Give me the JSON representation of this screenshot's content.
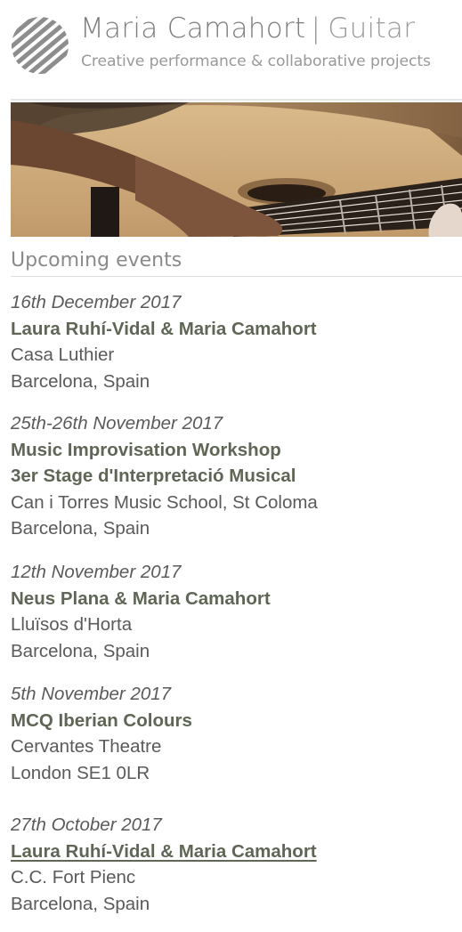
{
  "header": {
    "site_name": "Maria Camahort",
    "separator": "|",
    "instrument": "Guitar",
    "tagline": "Creative performance & collaborative projects",
    "logo_icon": "striped-circle-logo"
  },
  "hero": {
    "image": "guitar-player-hands-photo"
  },
  "section": {
    "title": "Upcoming events"
  },
  "events": [
    {
      "date": "16th December 2017",
      "titles": [
        "Laura Ruhí-Vidal & Maria Camahort"
      ],
      "venue": "Casa Luthier",
      "location": "Barcelona, Spain",
      "linked": false
    },
    {
      "date": "25th-26th November 2017",
      "titles": [
        "Music Improvisation Workshop",
        "3er Stage d'Interpretació Musical"
      ],
      "venue": "Can i Torres Music School, St Coloma",
      "location": "Barcelona, Spain",
      "linked": false
    },
    {
      "date": "12th November 2017",
      "titles": [
        "Neus Plana & Maria Camahort"
      ],
      "venue": "Lluïsos d'Horta",
      "location": "Barcelona, Spain",
      "linked": false
    },
    {
      "date": "5th November 2017",
      "titles": [
        "MCQ Iberian Colours"
      ],
      "venue": "Cervantes Theatre",
      "location": "London SE1 0LR",
      "linked": false
    },
    {
      "date": "27th October 2017",
      "titles": [
        "Laura Ruhí-Vidal & Maria Camahort"
      ],
      "venue": "C.C. Fort Pienc",
      "location": "Barcelona, Spain",
      "linked": true
    }
  ],
  "colors": {
    "title_text": "#5f6655",
    "body_text": "#5a5a5a",
    "header_text": "#7d7d7d"
  }
}
